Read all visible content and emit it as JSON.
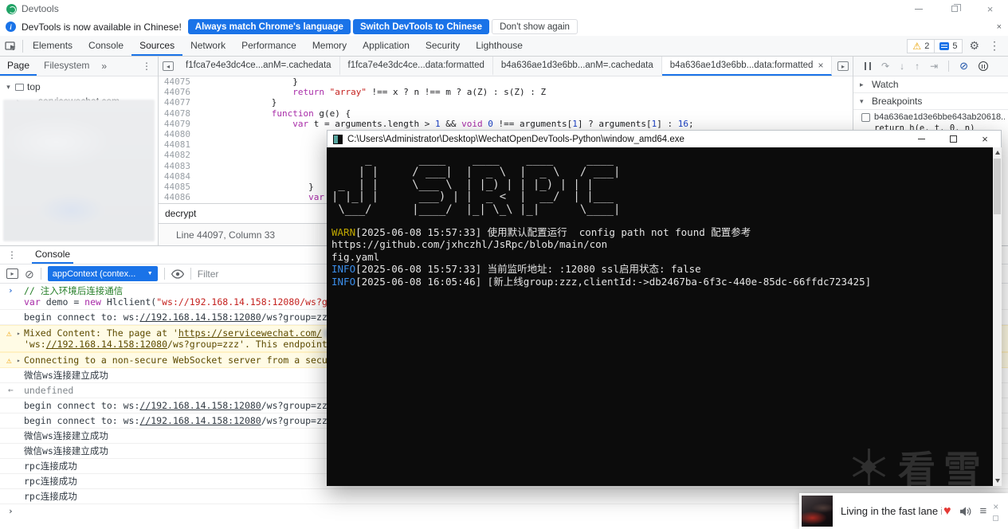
{
  "window": {
    "title": "Devtools"
  },
  "icons": {
    "close": "×",
    "kebab": "⋮",
    "overflow": "»",
    "expand_down": "▾",
    "expand_right": "▸",
    "warning": "⚠",
    "input_chevron": "›",
    "result_arrow": "←",
    "clear": "⊘",
    "dropdown_arrow": "▼",
    "heart": "♥",
    "playlist": "≡",
    "gear": "⚙",
    "step_over": "↷",
    "step_into": "↓",
    "step_out": "↑",
    "step": "⇥",
    "deactivate_breakpoints": "⊘",
    "cloud": "☁",
    "tab_nav_left": "◂",
    "tab_nav_right": "▸",
    "sidebar_toggle": "▸"
  },
  "infobar": {
    "message": "DevTools is now available in Chinese!",
    "buttons": [
      {
        "label": "Always match Chrome's language",
        "style": "primary"
      },
      {
        "label": "Switch DevTools to Chinese",
        "style": "primary"
      },
      {
        "label": "Don't show again",
        "style": "secondary"
      }
    ]
  },
  "main_tabs": {
    "items": [
      "Elements",
      "Console",
      "Sources",
      "Network",
      "Performance",
      "Memory",
      "Application",
      "Security",
      "Lighthouse"
    ],
    "active": "Sources",
    "warning_count": "2",
    "issue_count": "5"
  },
  "sidebar": {
    "tabs": [
      {
        "label": "Page",
        "active": true
      },
      {
        "label": "Filesystem",
        "active": false
      }
    ],
    "tree": [
      {
        "label": "top",
        "icon": "frame-icon",
        "state": "expanded",
        "depth": 0
      },
      {
        "label": "servicewechat.com",
        "icon": "cloud-icon",
        "state": "collapsed",
        "depth": 1
      }
    ]
  },
  "editor": {
    "file_tabs": [
      {
        "label": "f1fca7e4e3dc4ce...anM=.cachedata",
        "active": false
      },
      {
        "label": "f1fca7e4e3dc4ce...data:formatted",
        "active": false
      },
      {
        "label": "b4a636ae1d3e6bb...anM=.cachedata",
        "active": false
      },
      {
        "label": "b4a636ae1d3e6bb...data:formatted",
        "active": true
      }
    ],
    "lines": [
      {
        "num": "44075",
        "tokens": [
          {
            "t": "                  }",
            "s": "p"
          }
        ]
      },
      {
        "num": "44076",
        "tokens": [
          {
            "t": "                  ",
            "s": "p"
          },
          {
            "t": "return ",
            "s": "kw"
          },
          {
            "t": "\"array\"",
            "s": "str"
          },
          {
            "t": " !== x ? n !== m ? a(Z) : s(Z) : Z",
            "s": "p"
          }
        ]
      },
      {
        "num": "44077",
        "tokens": [
          {
            "t": "              }",
            "s": "p"
          }
        ]
      },
      {
        "num": "44078",
        "tokens": [
          {
            "t": "              ",
            "s": "p"
          },
          {
            "t": "function",
            "s": "kw"
          },
          {
            "t": " g(e) {",
            "s": "p"
          }
        ]
      },
      {
        "num": "44079",
        "tokens": [
          {
            "t": "                  ",
            "s": "p"
          },
          {
            "t": "var",
            "s": "kw"
          },
          {
            "t": " t = arguments.length > ",
            "s": "p"
          },
          {
            "t": "1",
            "s": "num"
          },
          {
            "t": " && ",
            "s": "p"
          },
          {
            "t": "void",
            "s": "kw"
          },
          {
            "t": " ",
            "s": "p"
          },
          {
            "t": "0",
            "s": "num"
          },
          {
            "t": " !== arguments[",
            "s": "p"
          },
          {
            "t": "1",
            "s": "num"
          },
          {
            "t": "] ? arguments[",
            "s": "p"
          },
          {
            "t": "1",
            "s": "num"
          },
          {
            "t": "] : ",
            "s": "p"
          },
          {
            "t": "16",
            "s": "num"
          },
          {
            "t": ";",
            "s": "p"
          }
        ]
      },
      {
        "num": "44080",
        "tokens": []
      },
      {
        "num": "44081",
        "tokens": []
      },
      {
        "num": "44082",
        "tokens": []
      },
      {
        "num": "44083",
        "tokens": []
      },
      {
        "num": "44084",
        "tokens": []
      },
      {
        "num": "44085",
        "tokens": [
          {
            "t": "                     }",
            "s": "p"
          }
        ]
      },
      {
        "num": "44086",
        "tokens": [
          {
            "t": "                     ",
            "s": "p"
          },
          {
            "t": "var",
            "s": "kw"
          },
          {
            "t": " ",
            "s": "p"
          }
        ]
      }
    ],
    "search_value": "decrypt",
    "status_text": "Line 44097, Column 33"
  },
  "debug_panel": {
    "watch_label": "Watch",
    "breakpoints_label": "Breakpoints",
    "breakpoint": {
      "file": "b4a636ae1d3e6bbe643ab20618...",
      "code": "return h(e, t, 0, n)",
      "checked": false
    }
  },
  "console": {
    "tab_label": "Console",
    "context_selector": "appContext (contex...",
    "filter_placeholder": "Filter",
    "messages": [
      {
        "kind": "input",
        "lines": [
          [
            {
              "t": "// 注入环境后连接通信",
              "s": "comment"
            }
          ],
          [
            {
              "t": "var ",
              "s": "kw"
            },
            {
              "t": "demo = ",
              "s": "p"
            },
            {
              "t": "new ",
              "s": "kw"
            },
            {
              "t": "Hlclient(",
              "s": "p"
            },
            {
              "t": "\"ws://192.168.14.158:12080/ws?group=zzz\"",
              "s": "str"
            },
            {
              "t": ");",
              "s": "p"
            }
          ]
        ]
      },
      {
        "kind": "log",
        "lines": [
          [
            {
              "t": "begin connect to: ws:",
              "s": "p"
            },
            {
              "t": "//192.168.14.158:12080",
              "s": "link"
            },
            {
              "t": "/ws?group=zzz",
              "s": "p"
            }
          ]
        ]
      },
      {
        "kind": "warn",
        "lines": [
          [
            {
              "t": "Mixed Content: The page at '",
              "s": "p"
            },
            {
              "t": "https://servicewechat.com/",
              "s": "link"
            },
            {
              "t": "",
              "s": "blur"
            }
          ],
          [
            {
              "t": "'ws:",
              "s": "p"
            },
            {
              "t": "//192.168.14.158:12080",
              "s": "link"
            },
            {
              "t": "/ws?group=zzz'. This endpoint should be a",
              "s": "p"
            }
          ]
        ]
      },
      {
        "kind": "warn",
        "lines": [
          [
            {
              "t": "Connecting to a non-secure WebSocket server from a secure origin i",
              "s": "p"
            }
          ]
        ]
      },
      {
        "kind": "log",
        "lines": [
          [
            {
              "t": "微信ws连接建立成功",
              "s": "p"
            }
          ]
        ]
      },
      {
        "kind": "result",
        "lines": [
          [
            {
              "t": "undefined",
              "s": "muted"
            }
          ]
        ]
      },
      {
        "kind": "log",
        "lines": [
          [
            {
              "t": "begin connect to: ws:",
              "s": "p"
            },
            {
              "t": "//192.168.14.158:12080",
              "s": "link"
            },
            {
              "t": "/ws?group=zzz",
              "s": "p"
            }
          ]
        ]
      },
      {
        "kind": "log",
        "lines": [
          [
            {
              "t": "begin connect to: ws:",
              "s": "p"
            },
            {
              "t": "//192.168.14.158:12080",
              "s": "link"
            },
            {
              "t": "/ws?group=zzz",
              "s": "p"
            }
          ]
        ]
      },
      {
        "kind": "log",
        "lines": [
          [
            {
              "t": "微信ws连接建立成功",
              "s": "p"
            }
          ]
        ]
      },
      {
        "kind": "log",
        "lines": [
          [
            {
              "t": "微信ws连接建立成功",
              "s": "p"
            }
          ]
        ]
      },
      {
        "kind": "log",
        "lines": [
          [
            {
              "t": "rpc连接成功",
              "s": "p"
            }
          ]
        ]
      },
      {
        "kind": "log",
        "lines": [
          [
            {
              "t": "rpc连接成功",
              "s": "p"
            }
          ]
        ]
      },
      {
        "kind": "log",
        "lines": [
          [
            {
              "t": "rpc连接成功",
              "s": "p"
            }
          ]
        ]
      },
      {
        "kind": "prompt",
        "lines": []
      }
    ]
  },
  "terminal": {
    "title": "C:\\Users\\Administrator\\Desktop\\WechatOpenDevTools-Python\\window_amd64.exe",
    "ascii_art": "     _       ____    ____    ____     ____ \n    | |     / ___|  |  _ \\  |  _ \\   / ___|\n _  | |     \\___ \\  | |_) | | |_) | | |    \n| |_| |      ___) | |  _ <  |  __/  | |___ \n \\___/      |____/  |_| \\_\\ |_|      \\____|",
    "logs": [
      {
        "level": "WARN",
        "text": "[2025-06-08 15:57:33] 使用默认配置运行  config path not found 配置参考 https://github.com/jxhczhl/JsRpc/blob/main/con"
      },
      {
        "level": "",
        "text": "fig.yaml"
      },
      {
        "level": "INFO",
        "text": "[2025-06-08 15:57:33] 当前监听地址: :12080 ssl启用状态: false"
      },
      {
        "level": "INFO",
        "text": "[2025-06-08 16:05:46] [新上线group:zzz,clientId:->db2467ba-6f3c-440e-85dc-66ffdc723425]"
      }
    ],
    "watermark_text": "看雪"
  },
  "media_popup": {
    "title": "Living in the fast lane is g"
  },
  "colors": {
    "accent_blue": "#1a73e8",
    "terminal_warn": "#c0a800",
    "terminal_info": "#3b8eea",
    "console_warn_bg": "#fffbe5"
  }
}
